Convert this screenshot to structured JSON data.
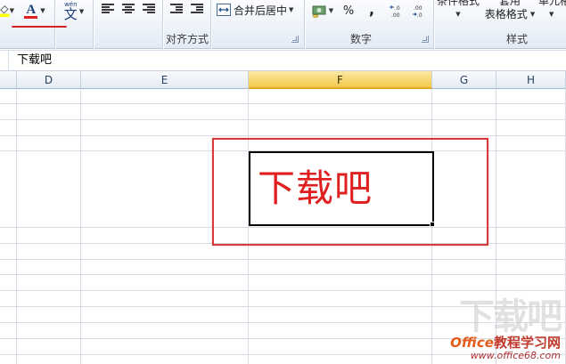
{
  "ribbon": {
    "font_color_letter": "A",
    "phonetic_top": "wén",
    "phonetic_main": "文",
    "merge_label": "合并后居中",
    "percent": "%",
    "comma": ",",
    "inc_decimal": ".0←.00",
    "dec_decimal": ".00→.0",
    "cond_format_label": "条件格式",
    "format_table_top": "套用",
    "format_table_label": "表格格式",
    "cell_styles_label": "单元格",
    "groups": {
      "alignment": "对齐方式",
      "number": "数字",
      "styles": "样式"
    },
    "colors": {
      "font_color": "#e02020",
      "fill_color": "#ffff00"
    }
  },
  "formula_bar": {
    "value": "下载吧"
  },
  "columns": [
    "D",
    "E",
    "F",
    "G",
    "H"
  ],
  "active_column": "F",
  "active_cell": {
    "value": "下载吧",
    "text_color": "#e02020"
  },
  "watermark": {
    "big": "下载吧",
    "brand_office": "Office",
    "brand_cn": "教程学习网",
    "url": "www.office68.com"
  }
}
